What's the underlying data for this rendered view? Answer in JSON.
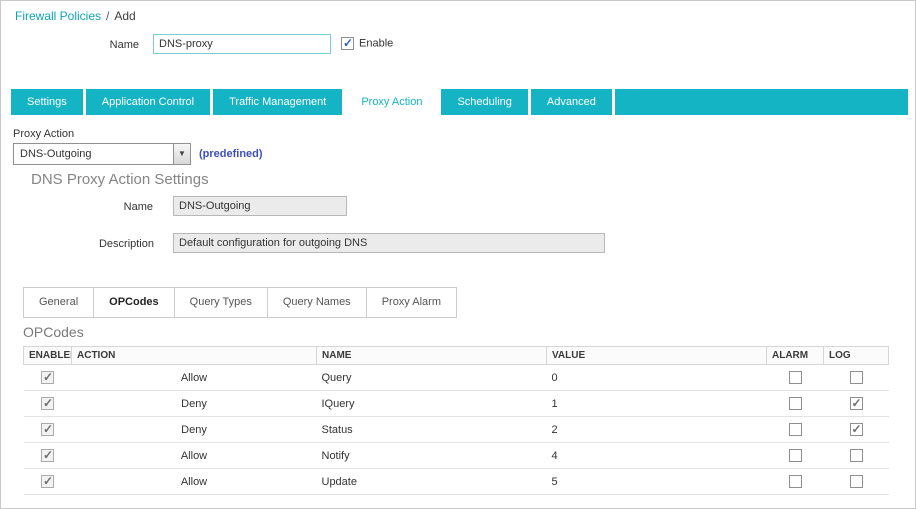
{
  "breadcrumb": {
    "link": "Firewall Policies",
    "separator": "/",
    "current": "Add"
  },
  "header": {
    "name_label": "Name",
    "name_value": "DNS-proxy",
    "enable_label": "Enable",
    "enable_checked": true
  },
  "tabs": {
    "items": [
      {
        "label": "Settings",
        "active": false
      },
      {
        "label": "Application Control",
        "active": false
      },
      {
        "label": "Traffic Management",
        "active": false
      },
      {
        "label": "Proxy Action",
        "active": true
      },
      {
        "label": "Scheduling",
        "active": false
      },
      {
        "label": "Advanced",
        "active": false
      }
    ]
  },
  "proxy_action": {
    "label": "Proxy Action",
    "selected": "DNS-Outgoing",
    "predefined": "(predefined)",
    "dropdown_arrow": "▼"
  },
  "action_settings": {
    "title": "DNS Proxy Action Settings",
    "name_label": "Name",
    "name_value": "DNS-Outgoing",
    "description_label": "Description",
    "description_value": "Default configuration for outgoing DNS"
  },
  "subtabs": {
    "items": [
      "General",
      "OPCodes",
      "Query Types",
      "Query Names",
      "Proxy Alarm"
    ],
    "active": "OPCodes"
  },
  "opcodes": {
    "title": "OPCodes",
    "columns": [
      "ENABLED",
      "ACTION",
      "NAME",
      "VALUE",
      "ALARM",
      "LOG"
    ],
    "rows": [
      {
        "enabled": true,
        "action": "Allow",
        "name": "Query",
        "value": "0",
        "alarm": false,
        "log": false
      },
      {
        "enabled": true,
        "action": "Deny",
        "name": "IQuery",
        "value": "1",
        "alarm": false,
        "log": true
      },
      {
        "enabled": true,
        "action": "Deny",
        "name": "Status",
        "value": "2",
        "alarm": false,
        "log": true
      },
      {
        "enabled": true,
        "action": "Allow",
        "name": "Notify",
        "value": "4",
        "alarm": false,
        "log": false
      },
      {
        "enabled": true,
        "action": "Allow",
        "name": "Update",
        "value": "5",
        "alarm": false,
        "log": false
      }
    ]
  },
  "colors": {
    "accent_teal": "#14b4c4",
    "link_teal": "#0da4b5",
    "link_blue": "#3f4fc1"
  }
}
